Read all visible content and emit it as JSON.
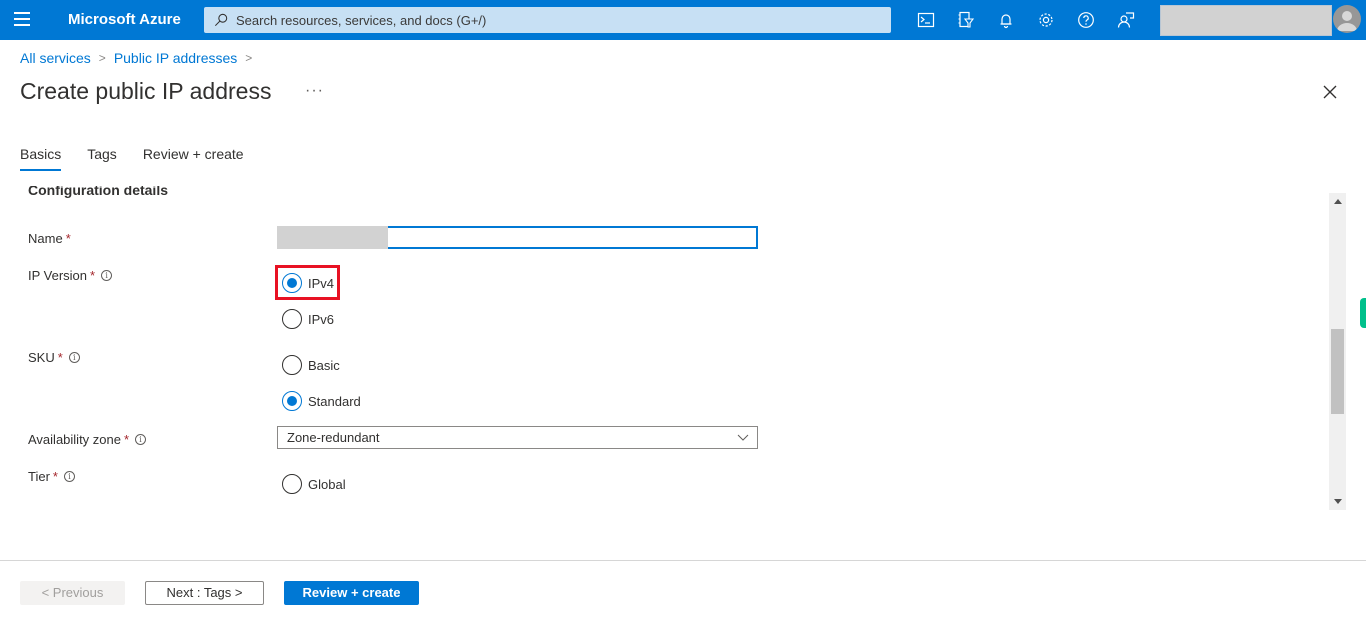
{
  "topbar": {
    "brand": "Microsoft Azure",
    "search_placeholder": "Search resources, services, and docs (G+/)",
    "icons": [
      "cloud-shell-icon",
      "directory-filter-icon",
      "notifications-icon",
      "settings-icon",
      "help-icon",
      "feedback-icon"
    ],
    "accent": "#0078d4"
  },
  "breadcrumb": {
    "items": [
      "All services",
      "Public IP addresses"
    ]
  },
  "header": {
    "title": "Create public IP address",
    "more_label": "···"
  },
  "tabs": [
    {
      "label": "Basics",
      "active": true
    },
    {
      "label": "Tags",
      "active": false
    },
    {
      "label": "Review + create",
      "active": false
    }
  ],
  "form": {
    "section_heading": "Configuration details",
    "name": {
      "label": "Name",
      "required": "*",
      "value": ""
    },
    "ip_version": {
      "label": "IP Version",
      "required": "*",
      "options": [
        {
          "label": "IPv4",
          "checked": true
        },
        {
          "label": "IPv6",
          "checked": false
        }
      ]
    },
    "sku": {
      "label": "SKU",
      "required": "*",
      "options": [
        {
          "label": "Basic",
          "checked": false
        },
        {
          "label": "Standard",
          "checked": true
        }
      ]
    },
    "availability_zone": {
      "label": "Availability zone",
      "required": "*",
      "value": "Zone-redundant"
    },
    "tier": {
      "label": "Tier",
      "required": "*",
      "options": [
        {
          "label": "Global",
          "checked": false
        }
      ]
    }
  },
  "footer": {
    "previous_label": "< Previous",
    "next_label": "Next : Tags >",
    "review_label": "Review + create"
  }
}
